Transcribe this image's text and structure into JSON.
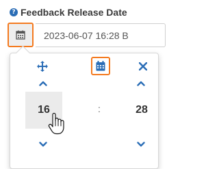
{
  "field": {
    "label": "Feedback Release Date",
    "help_icon": "question-circle-icon",
    "value": "2023-06-07 16:28 B"
  },
  "picker": {
    "hours": "16",
    "separator": ":",
    "minutes": "28",
    "icons": {
      "move": "move-arrows-icon",
      "calendar": "calendar-icon",
      "close": "close-icon",
      "up": "chevron-up-icon",
      "down": "chevron-down-icon"
    }
  },
  "colors": {
    "accent_orange": "#f47a1f",
    "icon_blue": "#2a6db6",
    "label_text": "#3a3a3a",
    "highlight_bg": "#ebebeb"
  }
}
